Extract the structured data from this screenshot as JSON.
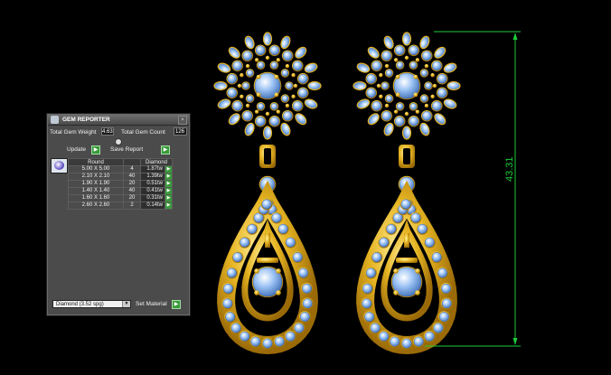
{
  "panel": {
    "title": "GEM REPORTER",
    "total_weight_label": "Total Gem Weight",
    "total_weight_value": "4.63",
    "total_count_label": "Total Gem Count",
    "total_count_value": "126",
    "update_label": "Update",
    "save_report_label": "Save Report",
    "table": {
      "headers": [
        "Round",
        "",
        "Diamond"
      ],
      "rows": [
        {
          "size": "5.00 X 5.00",
          "count": "4",
          "weight": "1.87tw"
        },
        {
          "size": "2.10 X 2.10",
          "count": "40",
          "weight": "1.39tw"
        },
        {
          "size": "1.90 X 1.90",
          "count": "20",
          "weight": "0.51tw"
        },
        {
          "size": "1.40 X 1.40",
          "count": "40",
          "weight": "0.41tw"
        },
        {
          "size": "1.60 X 1.60",
          "count": "20",
          "weight": "0.31tw"
        },
        {
          "size": "2.60 X 2.60",
          "count": "2",
          "weight": "0.14tw"
        }
      ]
    },
    "material_value": "Diamond   (3.52 spg)",
    "set_material_label": "Set Material"
  },
  "dimension": {
    "value": "43.31",
    "color": "#1dcc3a"
  },
  "colors": {
    "gold": "#e0b020",
    "gem": "#8fb8f0",
    "background": "#000000"
  }
}
